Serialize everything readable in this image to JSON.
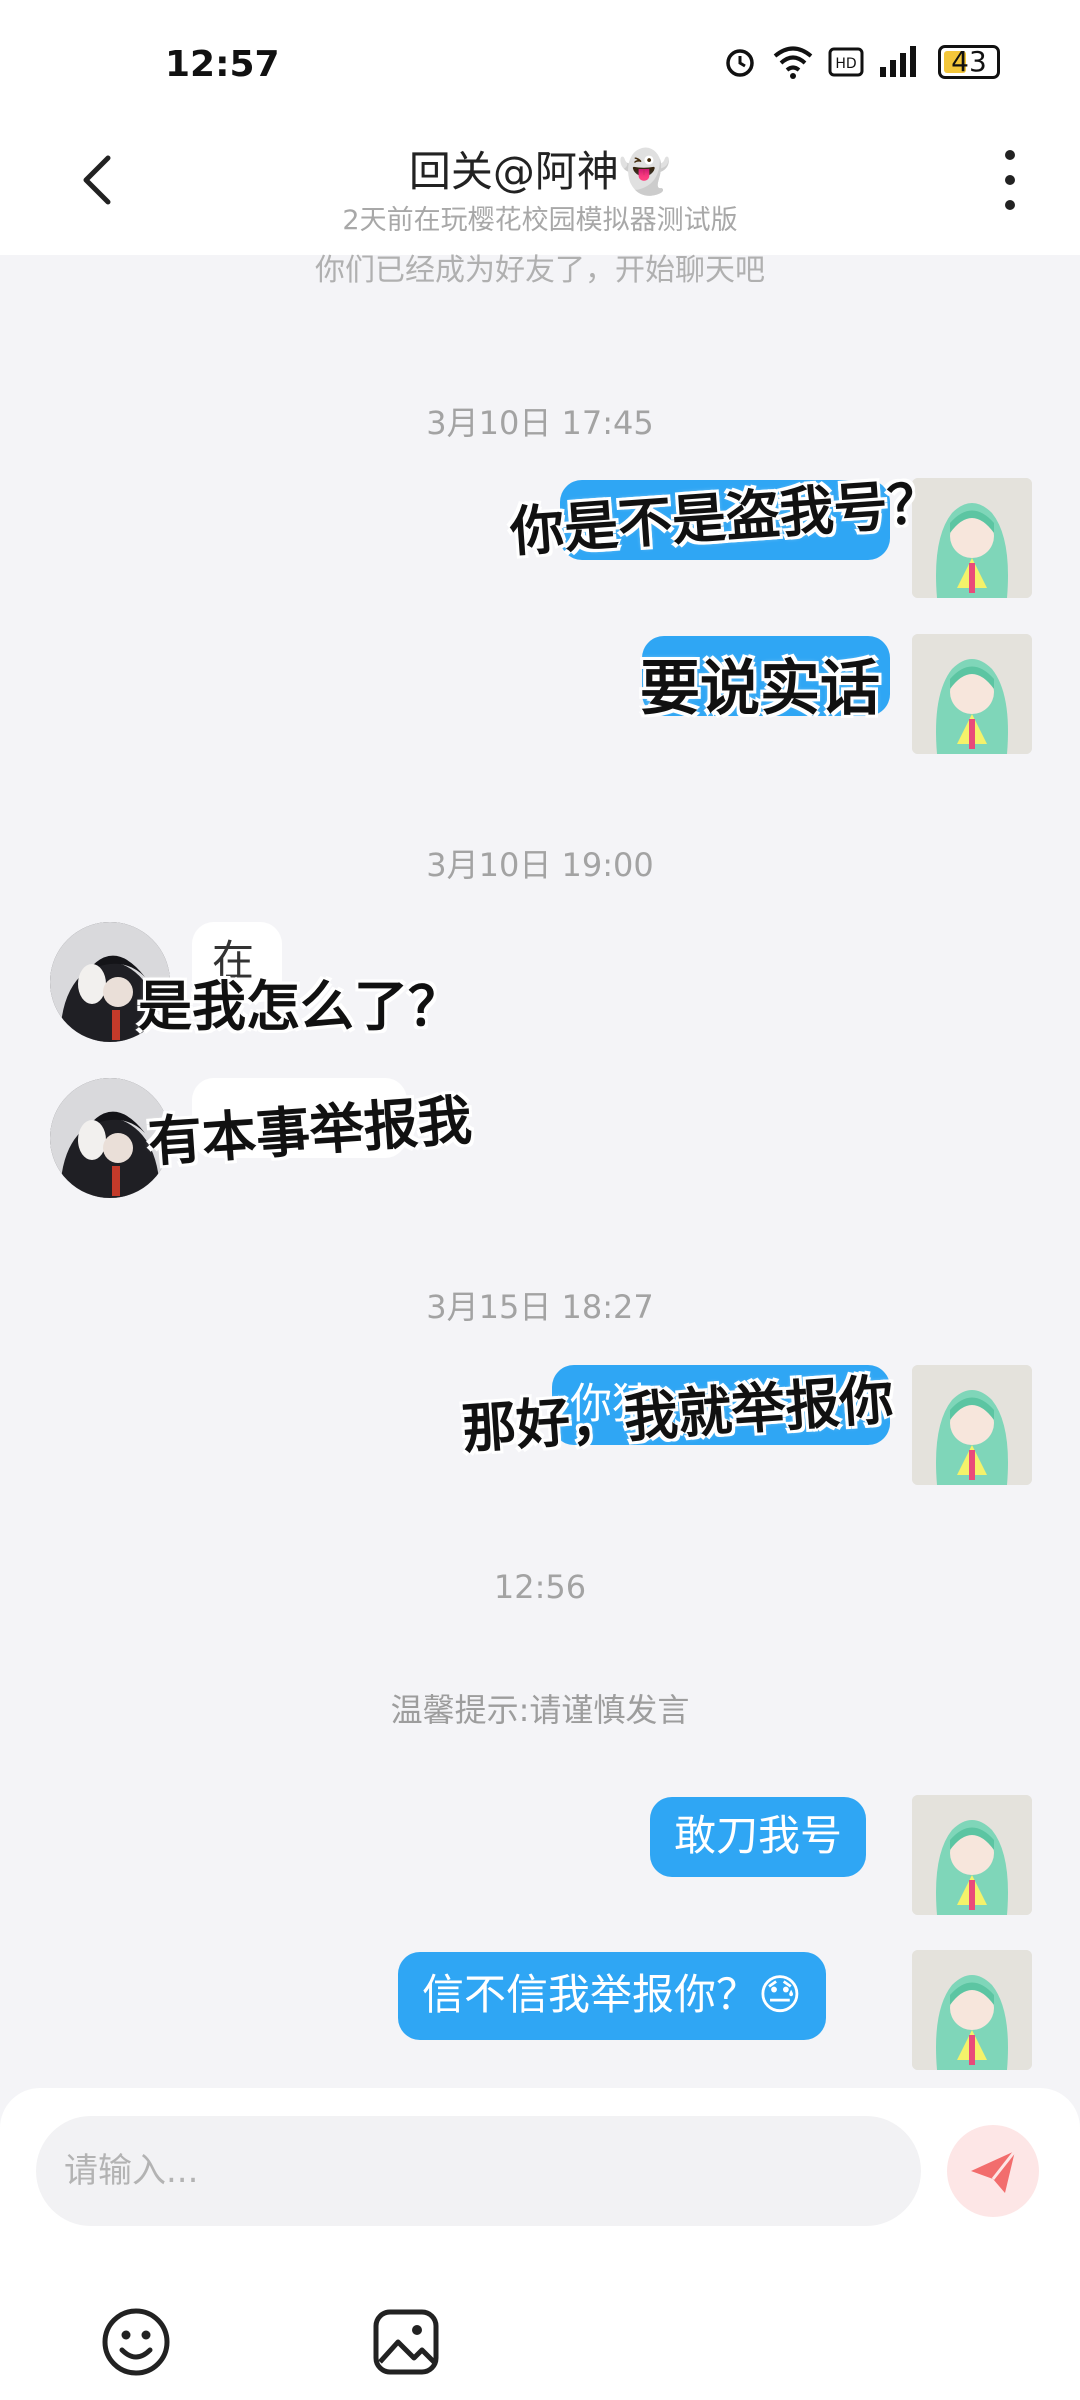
{
  "status_bar": {
    "time": "12:57",
    "battery": "43",
    "icons": [
      "alarm-icon",
      "wifi-icon",
      "hd-icon",
      "signal-icon",
      "battery-icon"
    ]
  },
  "header": {
    "title": "回关@阿神👻",
    "subtitle": "2天前在玩樱花校园模拟器测试版"
  },
  "chat": {
    "friend_note": "你们已经成为好友了，开始聊天吧",
    "time_1": "3月10日 17:45",
    "time_2": "3月10日 19:00",
    "time_3": "3月15日 18:27",
    "time_4": "12:56",
    "tip": "温馨提示:请谨慎发言",
    "msg_overlay_1": "你是不是盗我号？",
    "msg_overlay_2": "要说实话",
    "msg_theirs_1_partial": "在",
    "msg_overlay_3": "是我怎么了？",
    "msg_overlay_4": "有本事举报我",
    "msg_mine_3_partial": "你猜",
    "msg_overlay_5": "那好，我就举报你",
    "msg_mine_4": "敢刀我号",
    "msg_mine_5": "信不信我举报你？😓"
  },
  "input": {
    "placeholder": "请输入..."
  },
  "colors": {
    "bubble_mine": "#2fa6f4",
    "send_button_bg": "#fde6e6",
    "send_icon": "#f26d6d",
    "background": "#f4f4f7"
  }
}
